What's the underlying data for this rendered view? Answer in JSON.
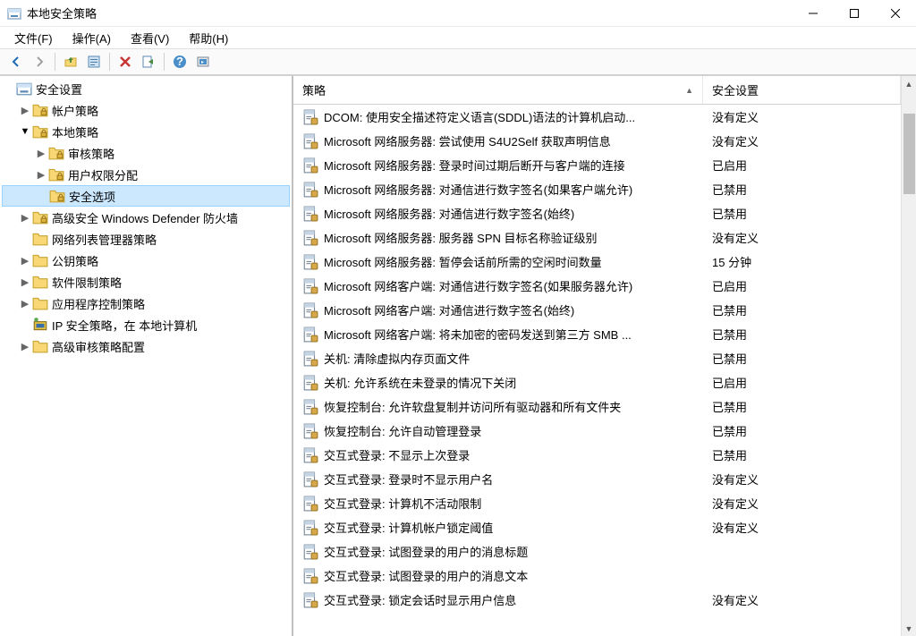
{
  "titlebar": {
    "title": "本地安全策略"
  },
  "menubar": {
    "items": [
      "文件(F)",
      "操作(A)",
      "查看(V)",
      "帮助(H)"
    ]
  },
  "tree": [
    {
      "level": 0,
      "label": "安全设置",
      "icon": "root",
      "expander": ""
    },
    {
      "level": 1,
      "label": "帐户策略",
      "icon": "folder-lock",
      "expander": ">"
    },
    {
      "level": 1,
      "label": "本地策略",
      "icon": "folder-lock",
      "expander": "v"
    },
    {
      "level": 2,
      "label": "审核策略",
      "icon": "folder-lock",
      "expander": ">"
    },
    {
      "level": 2,
      "label": "用户权限分配",
      "icon": "folder-lock",
      "expander": ">"
    },
    {
      "level": 2,
      "label": "安全选项",
      "icon": "folder-lock",
      "expander": "",
      "selected": true
    },
    {
      "level": 1,
      "label": "高级安全 Windows Defender 防火墙",
      "icon": "folder-lock",
      "expander": ">"
    },
    {
      "level": 1,
      "label": "网络列表管理器策略",
      "icon": "folder",
      "expander": ""
    },
    {
      "level": 1,
      "label": "公钥策略",
      "icon": "folder",
      "expander": ">"
    },
    {
      "level": 1,
      "label": "软件限制策略",
      "icon": "folder",
      "expander": ">"
    },
    {
      "level": 1,
      "label": "应用程序控制策略",
      "icon": "folder",
      "expander": ">"
    },
    {
      "level": 1,
      "label": "IP 安全策略，在 本地计算机",
      "icon": "ipsec",
      "expander": ""
    },
    {
      "level": 1,
      "label": "高级审核策略配置",
      "icon": "folder",
      "expander": ">"
    }
  ],
  "detail": {
    "columns": {
      "policy": "策略",
      "setting": "安全设置"
    },
    "rows": [
      {
        "policy": "DCOM: 使用安全描述符定义语言(SDDL)语法的计算机启动...",
        "setting": "没有定义"
      },
      {
        "policy": "Microsoft 网络服务器: 尝试使用 S4U2Self 获取声明信息",
        "setting": "没有定义"
      },
      {
        "policy": "Microsoft 网络服务器: 登录时间过期后断开与客户端的连接",
        "setting": "已启用"
      },
      {
        "policy": "Microsoft 网络服务器: 对通信进行数字签名(如果客户端允许)",
        "setting": "已禁用"
      },
      {
        "policy": "Microsoft 网络服务器: 对通信进行数字签名(始终)",
        "setting": "已禁用"
      },
      {
        "policy": "Microsoft 网络服务器: 服务器 SPN 目标名称验证级别",
        "setting": "没有定义"
      },
      {
        "policy": "Microsoft 网络服务器: 暂停会话前所需的空闲时间数量",
        "setting": "15 分钟"
      },
      {
        "policy": "Microsoft 网络客户端: 对通信进行数字签名(如果服务器允许)",
        "setting": "已启用"
      },
      {
        "policy": "Microsoft 网络客户端: 对通信进行数字签名(始终)",
        "setting": "已禁用"
      },
      {
        "policy": "Microsoft 网络客户端: 将未加密的密码发送到第三方 SMB ...",
        "setting": "已禁用"
      },
      {
        "policy": "关机: 清除虚拟内存页面文件",
        "setting": "已禁用"
      },
      {
        "policy": "关机: 允许系统在未登录的情况下关闭",
        "setting": "已启用"
      },
      {
        "policy": "恢复控制台: 允许软盘复制并访问所有驱动器和所有文件夹",
        "setting": "已禁用"
      },
      {
        "policy": "恢复控制台: 允许自动管理登录",
        "setting": "已禁用"
      },
      {
        "policy": "交互式登录: 不显示上次登录",
        "setting": "已禁用"
      },
      {
        "policy": "交互式登录: 登录时不显示用户名",
        "setting": "没有定义"
      },
      {
        "policy": "交互式登录: 计算机不活动限制",
        "setting": "没有定义"
      },
      {
        "policy": "交互式登录: 计算机帐户锁定阈值",
        "setting": "没有定义"
      },
      {
        "policy": "交互式登录: 试图登录的用户的消息标题",
        "setting": ""
      },
      {
        "policy": "交互式登录: 试图登录的用户的消息文本",
        "setting": ""
      },
      {
        "policy": "交互式登录: 锁定会话时显示用户信息",
        "setting": "没有定义"
      }
    ]
  }
}
